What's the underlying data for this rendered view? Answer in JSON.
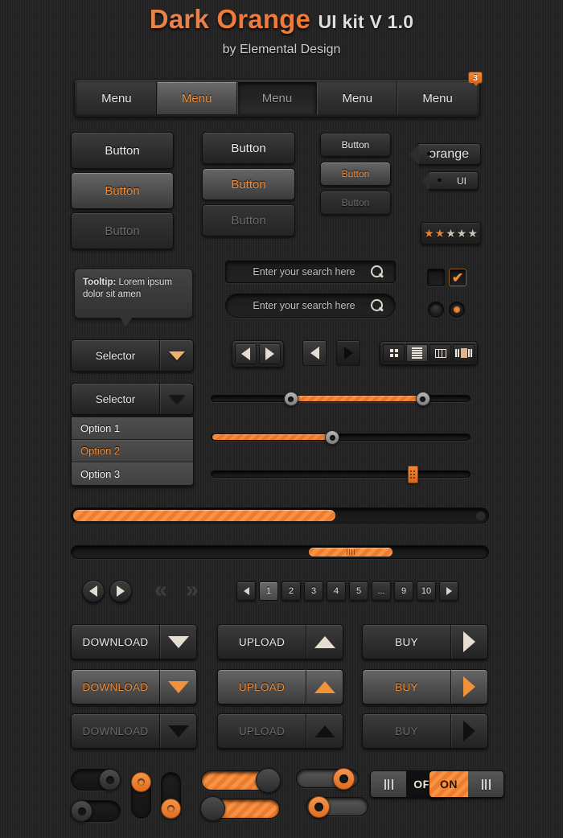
{
  "header": {
    "title_dark": "Dark",
    "title_orange": "Orange",
    "title_kit": "UI kit V 1.0",
    "subtitle": "by Elemental Design"
  },
  "menu": {
    "tabs": [
      {
        "label": "Menu",
        "state": "normal"
      },
      {
        "label": "Menu",
        "state": "active"
      },
      {
        "label": "Menu",
        "state": "pressed"
      },
      {
        "label": "Menu",
        "state": "normal"
      },
      {
        "label": "Menu",
        "state": "normal"
      }
    ],
    "badge": "3"
  },
  "buttons": {
    "large": [
      {
        "label": "Button",
        "state": "normal"
      },
      {
        "label": "Button",
        "state": "hover"
      },
      {
        "label": "Button",
        "state": "disabled"
      }
    ],
    "medium": [
      {
        "label": "Button",
        "state": "normal"
      },
      {
        "label": "Button",
        "state": "hover"
      },
      {
        "label": "Button",
        "state": "disabled"
      }
    ],
    "small": [
      {
        "label": "Button",
        "state": "normal"
      },
      {
        "label": "Button",
        "state": "hover"
      },
      {
        "label": "Button",
        "state": "disabled"
      }
    ]
  },
  "tags": [
    {
      "label": "orange"
    },
    {
      "label": "UI"
    }
  ],
  "rating": {
    "filled": 2,
    "total": 5,
    "star_glyph": "★",
    "filled_color": "#e8832f",
    "empty_color": "#c9c3ba"
  },
  "tooltip": {
    "label": "Tooltip:",
    "text": " Lorem ipsum dolor sit amen"
  },
  "search": {
    "placeholder": "Enter your search here",
    "value": "",
    "icon": "search-icon"
  },
  "checkboxes": {
    "unchecked_mark": "",
    "checked_mark": "✔"
  },
  "selectors": [
    {
      "label": "Selector",
      "arrow": "chevron-down-icon",
      "arrow_color": "#eeb26a"
    },
    {
      "label": "Selector",
      "arrow": "chevron-down-icon",
      "arrow_color": "#161616"
    }
  ],
  "dropdown": {
    "options": [
      {
        "label": "Option 1",
        "selected": false
      },
      {
        "label": "Option 2",
        "selected": true
      },
      {
        "label": "Option 3",
        "selected": false
      }
    ]
  },
  "view_modes": [
    {
      "name": "grid-view",
      "active": false
    },
    {
      "name": "list-view",
      "active": true
    },
    {
      "name": "column-view",
      "active": false
    },
    {
      "name": "coverflow-view",
      "active": false
    }
  ],
  "sliders": [
    {
      "name": "range-slider",
      "start": 30,
      "end": 83
    },
    {
      "name": "single-slider",
      "start": 0,
      "end": 47
    },
    {
      "name": "square-handle-slider",
      "start": 0,
      "end": 77
    }
  ],
  "progress": {
    "percent": 63
  },
  "scrollbar": {
    "thumb_start": 57,
    "thumb_width": 20
  },
  "pagination": {
    "pages": [
      "1",
      "2",
      "3",
      "4",
      "5",
      "...",
      "9",
      "10"
    ],
    "active": "1",
    "prev_icon": "arrow-left-icon",
    "next_icon": "arrow-right-icon",
    "first_icon": "double-chevron-left-icon",
    "last_icon": "double-chevron-right-icon",
    "first_glyph": "«",
    "last_glyph": "»"
  },
  "actions": {
    "rows": [
      {
        "state": "normal",
        "items": [
          {
            "label": "DOWNLOAD",
            "icon": "triangle-down-icon"
          },
          {
            "label": "UPLOAD",
            "icon": "triangle-up-icon"
          },
          {
            "label": "BUY",
            "icon": "triangle-right-icon"
          }
        ]
      },
      {
        "state": "hover",
        "items": [
          {
            "label": "DOWNLOAD",
            "icon": "triangle-down-icon"
          },
          {
            "label": "UPLOAD",
            "icon": "triangle-up-icon"
          },
          {
            "label": "BUY",
            "icon": "triangle-right-icon"
          }
        ]
      },
      {
        "state": "disabled",
        "items": [
          {
            "label": "DOWNLOAD",
            "icon": "triangle-down-icon"
          },
          {
            "label": "UPLOAD",
            "icon": "triangle-up-icon"
          },
          {
            "label": "BUY",
            "icon": "triangle-right-icon"
          }
        ]
      }
    ]
  },
  "switches": {
    "off_label": "OFF",
    "on_label": "ON"
  },
  "colors": {
    "accent": "#ef8c38",
    "accent_dark": "#d9661f",
    "background": "#262626",
    "panel": "#3a3a3a",
    "text": "#e6e6e6",
    "text_disabled": "#6c6c6c"
  }
}
